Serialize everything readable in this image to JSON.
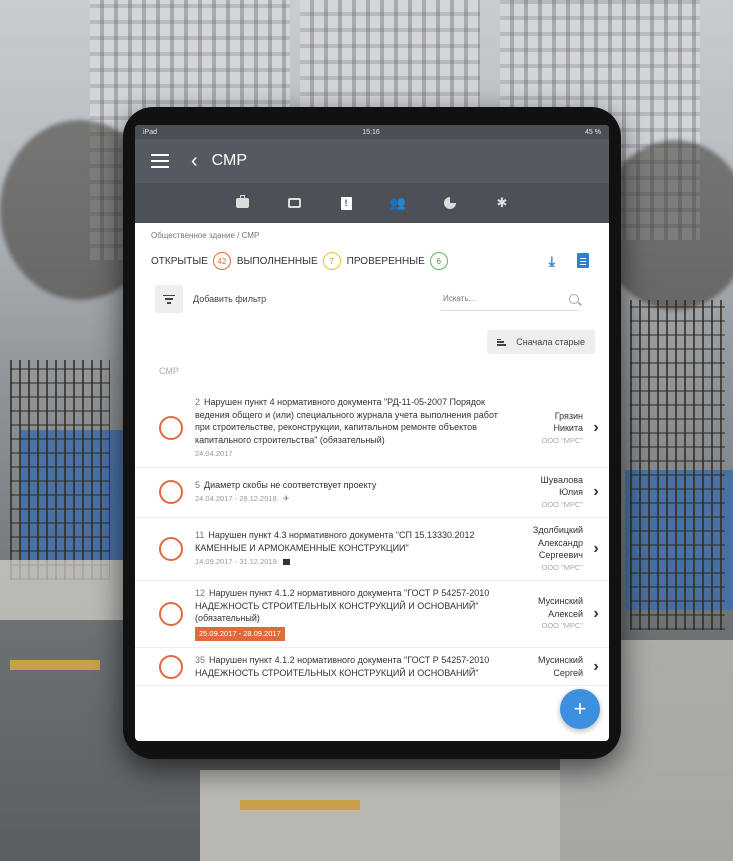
{
  "status": {
    "carrier": "iPad",
    "time": "15:16",
    "battery": "45 %"
  },
  "appbar": {
    "title": "СМР"
  },
  "breadcrumb": "Общественное здание / СМР",
  "counts": {
    "open_label": "ОТКРЫТЫЕ",
    "open_count": "42",
    "done_label": "ВЫПОЛНЕННЫЕ",
    "done_count": "7",
    "checked_label": "ПРОВЕРЕННЫЕ",
    "checked_count": "6"
  },
  "filter": {
    "add_label": "Добавить фильтр",
    "search_placeholder": "Искать..."
  },
  "sort": {
    "label": "Сначала старые"
  },
  "section": "СМР",
  "items": [
    {
      "num": "2",
      "text": "Нарушен пункт 4 нормативного документа \"РД-11-05-2007 Порядок ведения общего и (или) специального журнала учета выполнения работ при строительстве, реконструкции, капитальном ремонте объектов капитального строительства\" (обязательный)",
      "date": "24.04.2017",
      "name1": "Грязин",
      "name2": "Никита",
      "name3": "",
      "org": "ООО \"МРС\""
    },
    {
      "num": "5",
      "text": "Диаметр скобы не соответствует проекту",
      "date": "24.04.2017 - 28.12.2018",
      "name1": "Шувалова",
      "name2": "Юлия",
      "name3": "",
      "org": "ООО \"МРС\""
    },
    {
      "num": "11",
      "text": "Нарушен пункт 4.3 нормативного документа \"СП 15.13330.2012 КАМЕННЫЕ И АРМОКАМЕННЫЕ КОНСТРУКЦИИ\"",
      "date": "14.09.2017 - 31.12.2019",
      "name1": "Здолбицкий",
      "name2": "Александр",
      "name3": "Сергеевич",
      "org": "ООО \"МРС\""
    },
    {
      "num": "12",
      "text": "Нарушен пункт 4.1.2 нормативного документа \"ГОСТ Р 54257-2010 НАДЕЖНОСТЬ СТРОИТЕЛЬНЫХ КОНСТРУКЦИЙ И ОСНОВАНИЙ\" (обязательный)",
      "date": "25.09.2017 - 28.09.2017",
      "name1": "Мусинский",
      "name2": "Алексей",
      "name3": "",
      "org": "ООО \"МРС\""
    },
    {
      "num": "35",
      "text": "Нарушен пункт 4.1.2 нормативного документа \"ГОСТ Р 54257-2010 НАДЕЖНОСТЬ СТРОИТЕЛЬНЫХ КОНСТРУКЦИЙ И ОСНОВАНИЙ\"",
      "date": "",
      "name1": "Мусинский",
      "name2": "Сергей",
      "name3": "",
      "org": ""
    }
  ],
  "fab": "+"
}
